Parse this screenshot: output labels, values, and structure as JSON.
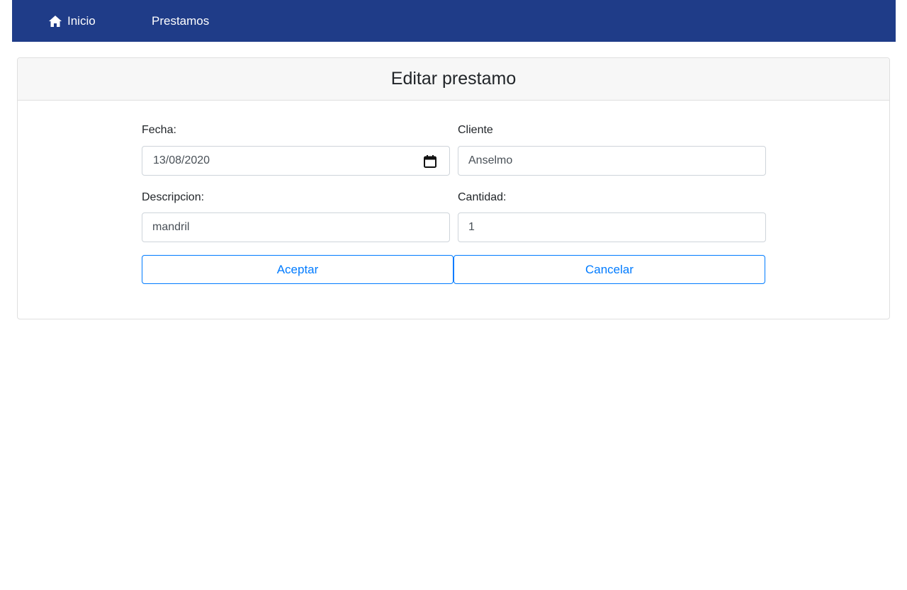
{
  "navbar": {
    "home_label": "Inicio",
    "home_icon": "home-icon",
    "prestamos_label": "Prestamos",
    "background": "#1f3c88"
  },
  "card": {
    "title": "Editar prestamo"
  },
  "form": {
    "fecha": {
      "label": "Fecha:",
      "value": "13/08/2020",
      "icon": "calendar-icon"
    },
    "cliente": {
      "label": "Cliente",
      "value": "Anselmo"
    },
    "descripcion": {
      "label": "Descripcion:",
      "value": "mandril"
    },
    "cantidad": {
      "label": "Cantidad:",
      "value": "1"
    }
  },
  "buttons": {
    "accept_label": "Aceptar",
    "cancel_label": "Cancelar",
    "accent": "#007bff"
  }
}
